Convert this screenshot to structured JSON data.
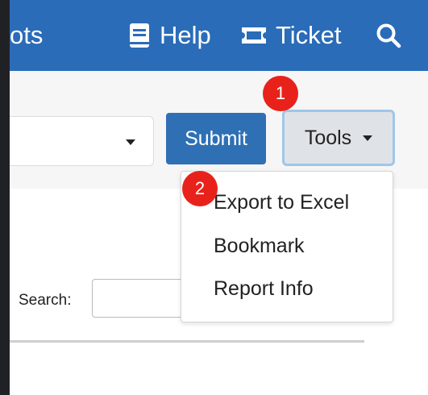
{
  "nav": {
    "partial_label": "ots",
    "help_label": "Help",
    "ticket_label": "Ticket",
    "search_icon": "search-icon",
    "help_icon": "book-icon",
    "ticket_icon": "ticket-icon"
  },
  "toolbar": {
    "submit_label": "Submit",
    "tools_label": "Tools",
    "select_value": ""
  },
  "dropdown": {
    "items": [
      "Export to Excel",
      "Bookmark",
      "Report Info"
    ]
  },
  "content": {
    "search_label": "Search:",
    "search_value": ""
  },
  "markers": [
    "1",
    "2"
  ],
  "colors": {
    "navbar": "#2a6cb8",
    "submit": "#2f70b4",
    "marker": "#e8221b"
  }
}
